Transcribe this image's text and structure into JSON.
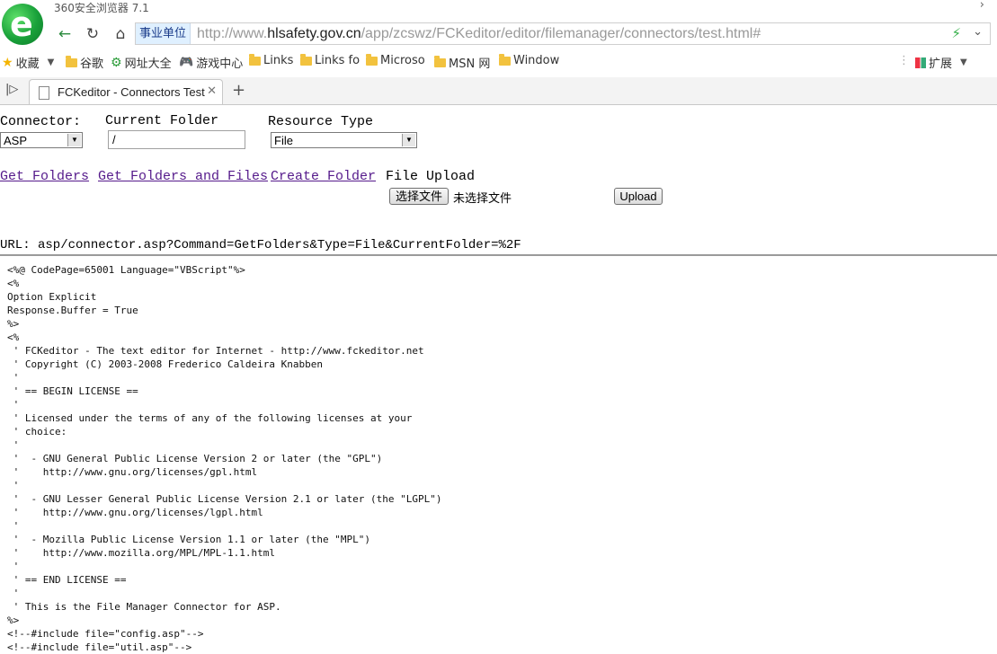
{
  "browser": {
    "app_title": "360安全浏览器 7.1",
    "zone_label": "事业单位",
    "url_prefix": "http://www.",
    "url_domain": "hlsafety.gov.cn",
    "url_path": "/app/zcswz/FCKeditor/editor/filemanager/connectors/test.html#"
  },
  "bookmarks": [
    {
      "label": "收藏",
      "icon": "star-icon"
    },
    {
      "label": "谷歌",
      "icon": "folder-icon"
    },
    {
      "label": "网址大全",
      "icon": "globe-icon"
    },
    {
      "label": "游戏中心",
      "icon": "gamepad-icon"
    },
    {
      "label": "Links",
      "icon": "folder-icon"
    },
    {
      "label": "Links fo",
      "icon": "folder-icon"
    },
    {
      "label": "Microso",
      "icon": "folder-icon"
    },
    {
      "label": "MSN 网",
      "icon": "folder-icon"
    },
    {
      "label": "Window",
      "icon": "folder-icon"
    }
  ],
  "extensions_label": "扩展",
  "tab": {
    "title": "FCKeditor - Connectors Test"
  },
  "page": {
    "connector_label": "Connector:",
    "connector_value": "ASP",
    "current_folder_label": "Current Folder",
    "current_folder_value": "/",
    "resource_type_label": "Resource Type",
    "resource_type_value": "File",
    "get_folders": "Get Folders",
    "get_folders_files": "Get Folders and Files",
    "create_folder": "Create Folder",
    "file_upload_label": "File Upload",
    "choose_file_button": "选择文件",
    "no_file_text": "未选择文件",
    "upload_button": "Upload",
    "request_url": "URL: asp/connector.asp?Command=GetFolders&Type=File&CurrentFolder=%2F"
  },
  "code_lines": [
    "<%@ CodePage=65001 Language=\"VBScript\"%>",
    "<%",
    "Option Explicit",
    "Response.Buffer = True",
    "%>",
    "<%",
    " ' FCKeditor - The text editor for Internet - http://www.fckeditor.net",
    " ' Copyright (C) 2003-2008 Frederico Caldeira Knabben",
    " '",
    " ' == BEGIN LICENSE ==",
    " '",
    " ' Licensed under the terms of any of the following licenses at your",
    " ' choice:",
    " '",
    " '  - GNU General Public License Version 2 or later (the \"GPL\")",
    " '    http://www.gnu.org/licenses/gpl.html",
    " '",
    " '  - GNU Lesser General Public License Version 2.1 or later (the \"LGPL\")",
    " '    http://www.gnu.org/licenses/lgpl.html",
    " '",
    " '  - Mozilla Public License Version 1.1 or later (the \"MPL\")",
    " '    http://www.mozilla.org/MPL/MPL-1.1.html",
    " '",
    " ' == END LICENSE ==",
    " '",
    " ' This is the File Manager Connector for ASP.",
    "%>",
    "<!--#include file=\"config.asp\"-->",
    "<!--#include file=\"util.asp\"-->"
  ]
}
